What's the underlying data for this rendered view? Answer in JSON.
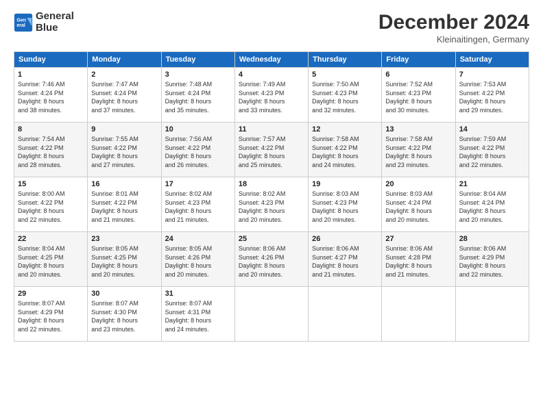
{
  "header": {
    "logo_line1": "General",
    "logo_line2": "Blue",
    "month_title": "December 2024",
    "location": "Kleinaitingen, Germany"
  },
  "weekdays": [
    "Sunday",
    "Monday",
    "Tuesday",
    "Wednesday",
    "Thursday",
    "Friday",
    "Saturday"
  ],
  "weeks": [
    [
      {
        "day": "1",
        "info": "Sunrise: 7:46 AM\nSunset: 4:24 PM\nDaylight: 8 hours\nand 38 minutes."
      },
      {
        "day": "2",
        "info": "Sunrise: 7:47 AM\nSunset: 4:24 PM\nDaylight: 8 hours\nand 37 minutes."
      },
      {
        "day": "3",
        "info": "Sunrise: 7:48 AM\nSunset: 4:24 PM\nDaylight: 8 hours\nand 35 minutes."
      },
      {
        "day": "4",
        "info": "Sunrise: 7:49 AM\nSunset: 4:23 PM\nDaylight: 8 hours\nand 33 minutes."
      },
      {
        "day": "5",
        "info": "Sunrise: 7:50 AM\nSunset: 4:23 PM\nDaylight: 8 hours\nand 32 minutes."
      },
      {
        "day": "6",
        "info": "Sunrise: 7:52 AM\nSunset: 4:23 PM\nDaylight: 8 hours\nand 30 minutes."
      },
      {
        "day": "7",
        "info": "Sunrise: 7:53 AM\nSunset: 4:22 PM\nDaylight: 8 hours\nand 29 minutes."
      }
    ],
    [
      {
        "day": "8",
        "info": "Sunrise: 7:54 AM\nSunset: 4:22 PM\nDaylight: 8 hours\nand 28 minutes."
      },
      {
        "day": "9",
        "info": "Sunrise: 7:55 AM\nSunset: 4:22 PM\nDaylight: 8 hours\nand 27 minutes."
      },
      {
        "day": "10",
        "info": "Sunrise: 7:56 AM\nSunset: 4:22 PM\nDaylight: 8 hours\nand 26 minutes."
      },
      {
        "day": "11",
        "info": "Sunrise: 7:57 AM\nSunset: 4:22 PM\nDaylight: 8 hours\nand 25 minutes."
      },
      {
        "day": "12",
        "info": "Sunrise: 7:58 AM\nSunset: 4:22 PM\nDaylight: 8 hours\nand 24 minutes."
      },
      {
        "day": "13",
        "info": "Sunrise: 7:58 AM\nSunset: 4:22 PM\nDaylight: 8 hours\nand 23 minutes."
      },
      {
        "day": "14",
        "info": "Sunrise: 7:59 AM\nSunset: 4:22 PM\nDaylight: 8 hours\nand 22 minutes."
      }
    ],
    [
      {
        "day": "15",
        "info": "Sunrise: 8:00 AM\nSunset: 4:22 PM\nDaylight: 8 hours\nand 22 minutes."
      },
      {
        "day": "16",
        "info": "Sunrise: 8:01 AM\nSunset: 4:22 PM\nDaylight: 8 hours\nand 21 minutes."
      },
      {
        "day": "17",
        "info": "Sunrise: 8:02 AM\nSunset: 4:23 PM\nDaylight: 8 hours\nand 21 minutes."
      },
      {
        "day": "18",
        "info": "Sunrise: 8:02 AM\nSunset: 4:23 PM\nDaylight: 8 hours\nand 20 minutes."
      },
      {
        "day": "19",
        "info": "Sunrise: 8:03 AM\nSunset: 4:23 PM\nDaylight: 8 hours\nand 20 minutes."
      },
      {
        "day": "20",
        "info": "Sunrise: 8:03 AM\nSunset: 4:24 PM\nDaylight: 8 hours\nand 20 minutes."
      },
      {
        "day": "21",
        "info": "Sunrise: 8:04 AM\nSunset: 4:24 PM\nDaylight: 8 hours\nand 20 minutes."
      }
    ],
    [
      {
        "day": "22",
        "info": "Sunrise: 8:04 AM\nSunset: 4:25 PM\nDaylight: 8 hours\nand 20 minutes."
      },
      {
        "day": "23",
        "info": "Sunrise: 8:05 AM\nSunset: 4:25 PM\nDaylight: 8 hours\nand 20 minutes."
      },
      {
        "day": "24",
        "info": "Sunrise: 8:05 AM\nSunset: 4:26 PM\nDaylight: 8 hours\nand 20 minutes."
      },
      {
        "day": "25",
        "info": "Sunrise: 8:06 AM\nSunset: 4:26 PM\nDaylight: 8 hours\nand 20 minutes."
      },
      {
        "day": "26",
        "info": "Sunrise: 8:06 AM\nSunset: 4:27 PM\nDaylight: 8 hours\nand 21 minutes."
      },
      {
        "day": "27",
        "info": "Sunrise: 8:06 AM\nSunset: 4:28 PM\nDaylight: 8 hours\nand 21 minutes."
      },
      {
        "day": "28",
        "info": "Sunrise: 8:06 AM\nSunset: 4:29 PM\nDaylight: 8 hours\nand 22 minutes."
      }
    ],
    [
      {
        "day": "29",
        "info": "Sunrise: 8:07 AM\nSunset: 4:29 PM\nDaylight: 8 hours\nand 22 minutes."
      },
      {
        "day": "30",
        "info": "Sunrise: 8:07 AM\nSunset: 4:30 PM\nDaylight: 8 hours\nand 23 minutes."
      },
      {
        "day": "31",
        "info": "Sunrise: 8:07 AM\nSunset: 4:31 PM\nDaylight: 8 hours\nand 24 minutes."
      },
      {
        "day": "",
        "info": ""
      },
      {
        "day": "",
        "info": ""
      },
      {
        "day": "",
        "info": ""
      },
      {
        "day": "",
        "info": ""
      }
    ]
  ]
}
